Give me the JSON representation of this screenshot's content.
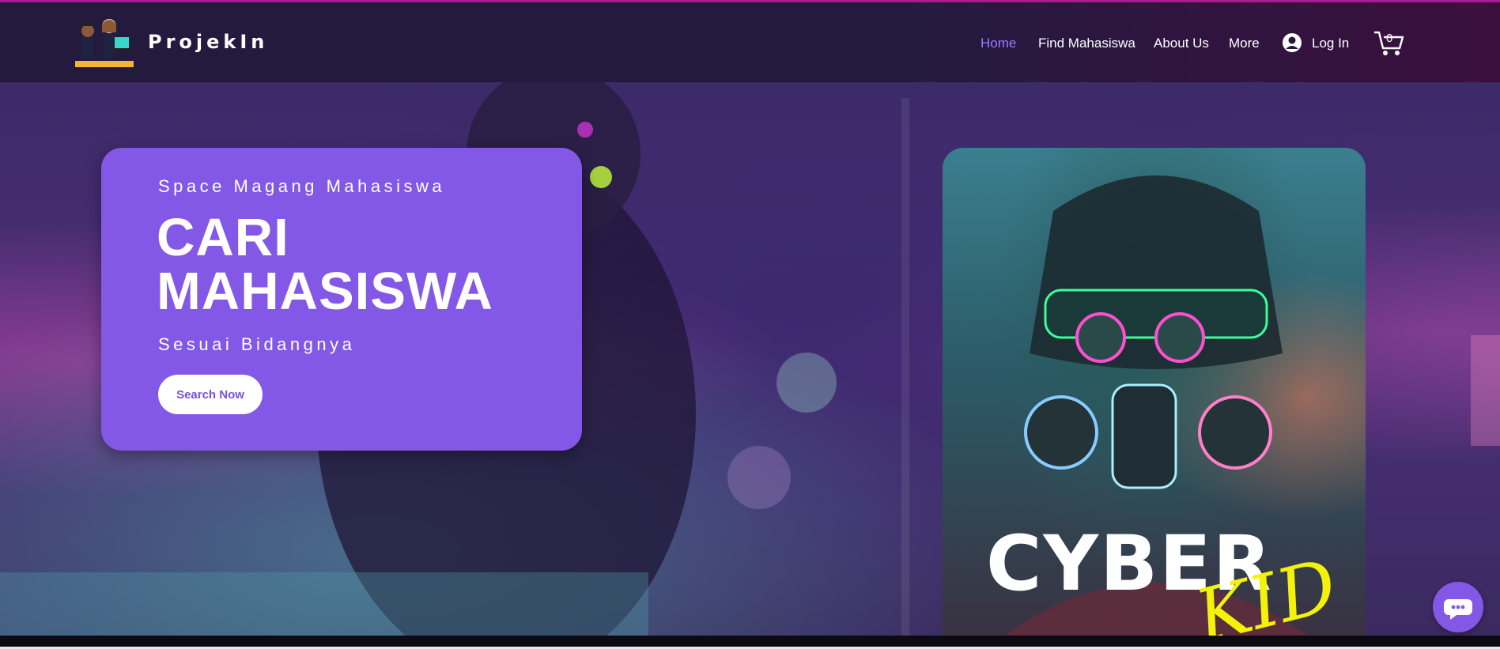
{
  "header": {
    "brand": "ProjekIn",
    "nav": {
      "home": "Home",
      "find": "Find Mahasiswa",
      "about": "About Us",
      "more": "More",
      "login": "Log In"
    },
    "cart_count": "0"
  },
  "hero": {
    "subtitle": "Space Magang Mahasiswa",
    "title_line1": "CARI",
    "title_line2": "MAHASISWA",
    "tagline": "Sesuai Bidangnya",
    "cta": "Search Now"
  },
  "poster": {
    "title": "CYBER",
    "script": "KID"
  },
  "colors": {
    "accent": "#8358e6",
    "nav_active": "#9b7cff",
    "header_bg": "#231a3d"
  },
  "icons": {
    "login": "user-circle-icon",
    "cart": "cart-icon",
    "chat": "chat-bubble-icon"
  }
}
